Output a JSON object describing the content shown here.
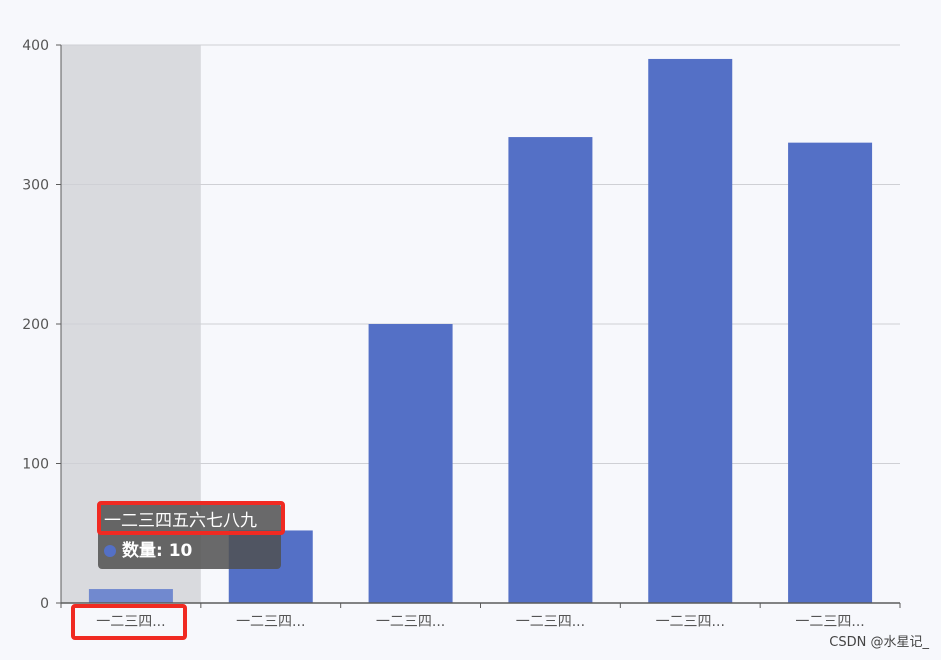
{
  "chart_data": {
    "type": "bar",
    "categories": [
      "一二三四...",
      "一二三四...",
      "一二三四...",
      "一二三四...",
      "一二三四...",
      "一二三四..."
    ],
    "values": [
      10,
      52,
      200,
      334,
      390,
      330
    ],
    "ylim": [
      0,
      400
    ],
    "yticks": [
      0,
      100,
      200,
      300,
      400
    ],
    "grid": true,
    "highlighted_index": 0
  },
  "colors": {
    "bar": "#5470c6",
    "bar_emphasis": "#7189cf",
    "axis_pointer_shadow": "#d9dade",
    "grid_line": "#cfd0d5",
    "axis_line": "#5c5c5c",
    "label": "#555555",
    "highlight_border": "#f02a22"
  },
  "tooltip": {
    "title": "一二三四五六七八九",
    "series_name": "数量",
    "value": "10",
    "row_text": "数量: 10",
    "dot_color": "#5470c6"
  },
  "watermark": "CSDN @水星记_"
}
